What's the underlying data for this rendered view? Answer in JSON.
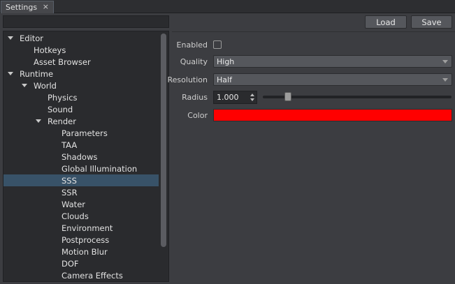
{
  "tab": {
    "title": "Settings",
    "close": "×"
  },
  "search": {
    "value": "",
    "placeholder": ""
  },
  "tree": {
    "items": [
      {
        "label": "Editor",
        "depth": 0,
        "expandable": true,
        "selected": false
      },
      {
        "label": "Hotkeys",
        "depth": 1,
        "expandable": false,
        "selected": false
      },
      {
        "label": "Asset Browser",
        "depth": 1,
        "expandable": false,
        "selected": false
      },
      {
        "label": "Runtime",
        "depth": 0,
        "expandable": true,
        "selected": false
      },
      {
        "label": "World",
        "depth": 1,
        "expandable": true,
        "selected": false
      },
      {
        "label": "Physics",
        "depth": 2,
        "expandable": false,
        "selected": false
      },
      {
        "label": "Sound",
        "depth": 2,
        "expandable": false,
        "selected": false
      },
      {
        "label": "Render",
        "depth": 2,
        "expandable": true,
        "selected": false
      },
      {
        "label": "Parameters",
        "depth": 3,
        "expandable": false,
        "selected": false
      },
      {
        "label": "TAA",
        "depth": 3,
        "expandable": false,
        "selected": false
      },
      {
        "label": "Shadows",
        "depth": 3,
        "expandable": false,
        "selected": false
      },
      {
        "label": "Global Illumination",
        "depth": 3,
        "expandable": false,
        "selected": false
      },
      {
        "label": "SSS",
        "depth": 3,
        "expandable": false,
        "selected": true
      },
      {
        "label": "SSR",
        "depth": 3,
        "expandable": false,
        "selected": false
      },
      {
        "label": "Water",
        "depth": 3,
        "expandable": false,
        "selected": false
      },
      {
        "label": "Clouds",
        "depth": 3,
        "expandable": false,
        "selected": false
      },
      {
        "label": "Environment",
        "depth": 3,
        "expandable": false,
        "selected": false
      },
      {
        "label": "Postprocess",
        "depth": 3,
        "expandable": false,
        "selected": false
      },
      {
        "label": "Motion Blur",
        "depth": 3,
        "expandable": false,
        "selected": false
      },
      {
        "label": "DOF",
        "depth": 3,
        "expandable": false,
        "selected": false
      },
      {
        "label": "Camera Effects",
        "depth": 3,
        "expandable": false,
        "selected": false
      }
    ]
  },
  "toolbar": {
    "load_label": "Load",
    "save_label": "Save"
  },
  "settings": {
    "enabled": {
      "label": "Enabled",
      "checked": false
    },
    "quality": {
      "label": "Quality",
      "value": "High"
    },
    "resolution": {
      "label": "Resolution",
      "value": "Half"
    },
    "radius": {
      "label": "Radius",
      "value": "1.000",
      "slider_fraction": 0.12
    },
    "color": {
      "label": "Color",
      "value": "#ff0000"
    }
  },
  "colors": {
    "selection": "#385268",
    "accent_red": "#ff0000"
  }
}
